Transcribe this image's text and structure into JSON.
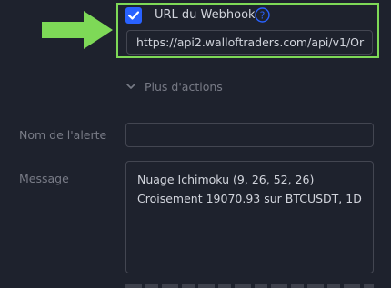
{
  "webhook": {
    "enabled": true,
    "label": "URL du Webhook",
    "url_value": "https://api2.walloftraders.com/api/v1/Or"
  },
  "more_actions": {
    "label": "Plus d'actions"
  },
  "alert_name": {
    "label": "Nom de l'alerte",
    "value": ""
  },
  "message": {
    "label": "Message",
    "lines": [
      "Nuage Ichimoku (9, 26, 52, 26)",
      "Croisement 19070.93 sur BTCUSDT, 1D"
    ]
  },
  "colors": {
    "background": "#1e222d",
    "accent_blue": "#2962ff",
    "highlight_green": "#7ed957",
    "muted_text": "#787b86",
    "border": "#434651"
  },
  "icons": [
    "check-icon",
    "help-icon",
    "chevron-down-icon",
    "arrow-right-icon"
  ]
}
